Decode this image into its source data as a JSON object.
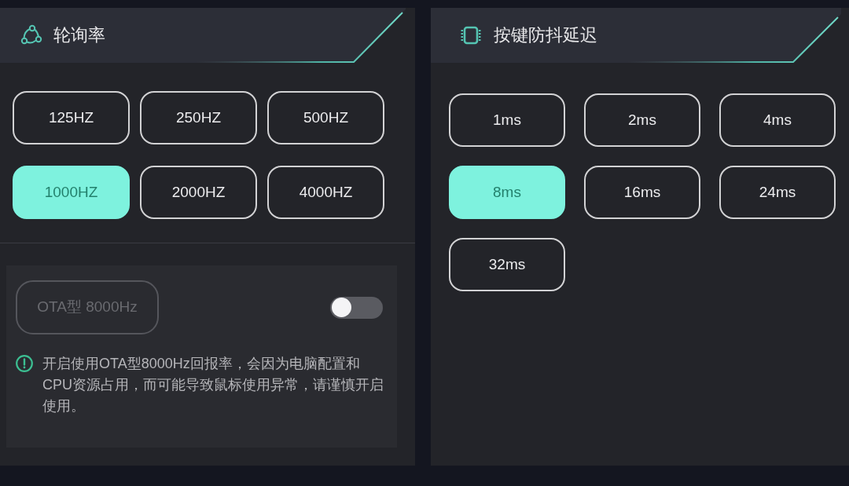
{
  "polling_rate": {
    "title": "轮询率",
    "options": [
      {
        "label": "125HZ",
        "selected": false
      },
      {
        "label": "250HZ",
        "selected": false
      },
      {
        "label": "500HZ",
        "selected": false
      },
      {
        "label": "1000HZ",
        "selected": true
      },
      {
        "label": "2000HZ",
        "selected": false
      },
      {
        "label": "4000HZ",
        "selected": false
      }
    ]
  },
  "ota_mode": {
    "label": "OTA型 8000Hz",
    "disabled": true,
    "on": false,
    "warning": "开启使用OTA型8000Hz回报率，会因为电脑配置和CPU资源占用，而可能导致鼠标使用异常，请谨慎开启使用。"
  },
  "debounce_delay": {
    "title": "按键防抖延迟",
    "options": [
      {
        "label": "1ms",
        "selected": false
      },
      {
        "label": "2ms",
        "selected": false
      },
      {
        "label": "4ms",
        "selected": false
      },
      {
        "label": "8ms",
        "selected": true
      },
      {
        "label": "16ms",
        "selected": false
      },
      {
        "label": "24ms",
        "selected": false
      },
      {
        "label": "32ms",
        "selected": false
      }
    ]
  }
}
